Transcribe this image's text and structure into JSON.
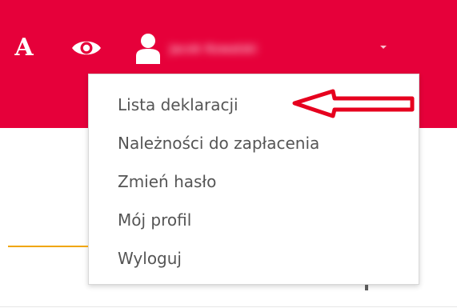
{
  "header": {
    "font_size_label": "A",
    "user_name": "Jacek Kowalski",
    "background_color": "#e6003a"
  },
  "icons": {
    "contrast": "eye-icon",
    "user": "user-icon",
    "caret": "caret-down-icon"
  },
  "menu": {
    "items": [
      {
        "label": "Lista deklaracji"
      },
      {
        "label": "Należności do zapłacenia"
      },
      {
        "label": "Zmień hasło"
      },
      {
        "label": "Mój profil"
      },
      {
        "label": "Wyloguj"
      }
    ]
  },
  "annotation": {
    "arrow_color": "#e6001e"
  },
  "accent_colors": {
    "brand": "#e6003a",
    "underline": "#f0a500"
  }
}
